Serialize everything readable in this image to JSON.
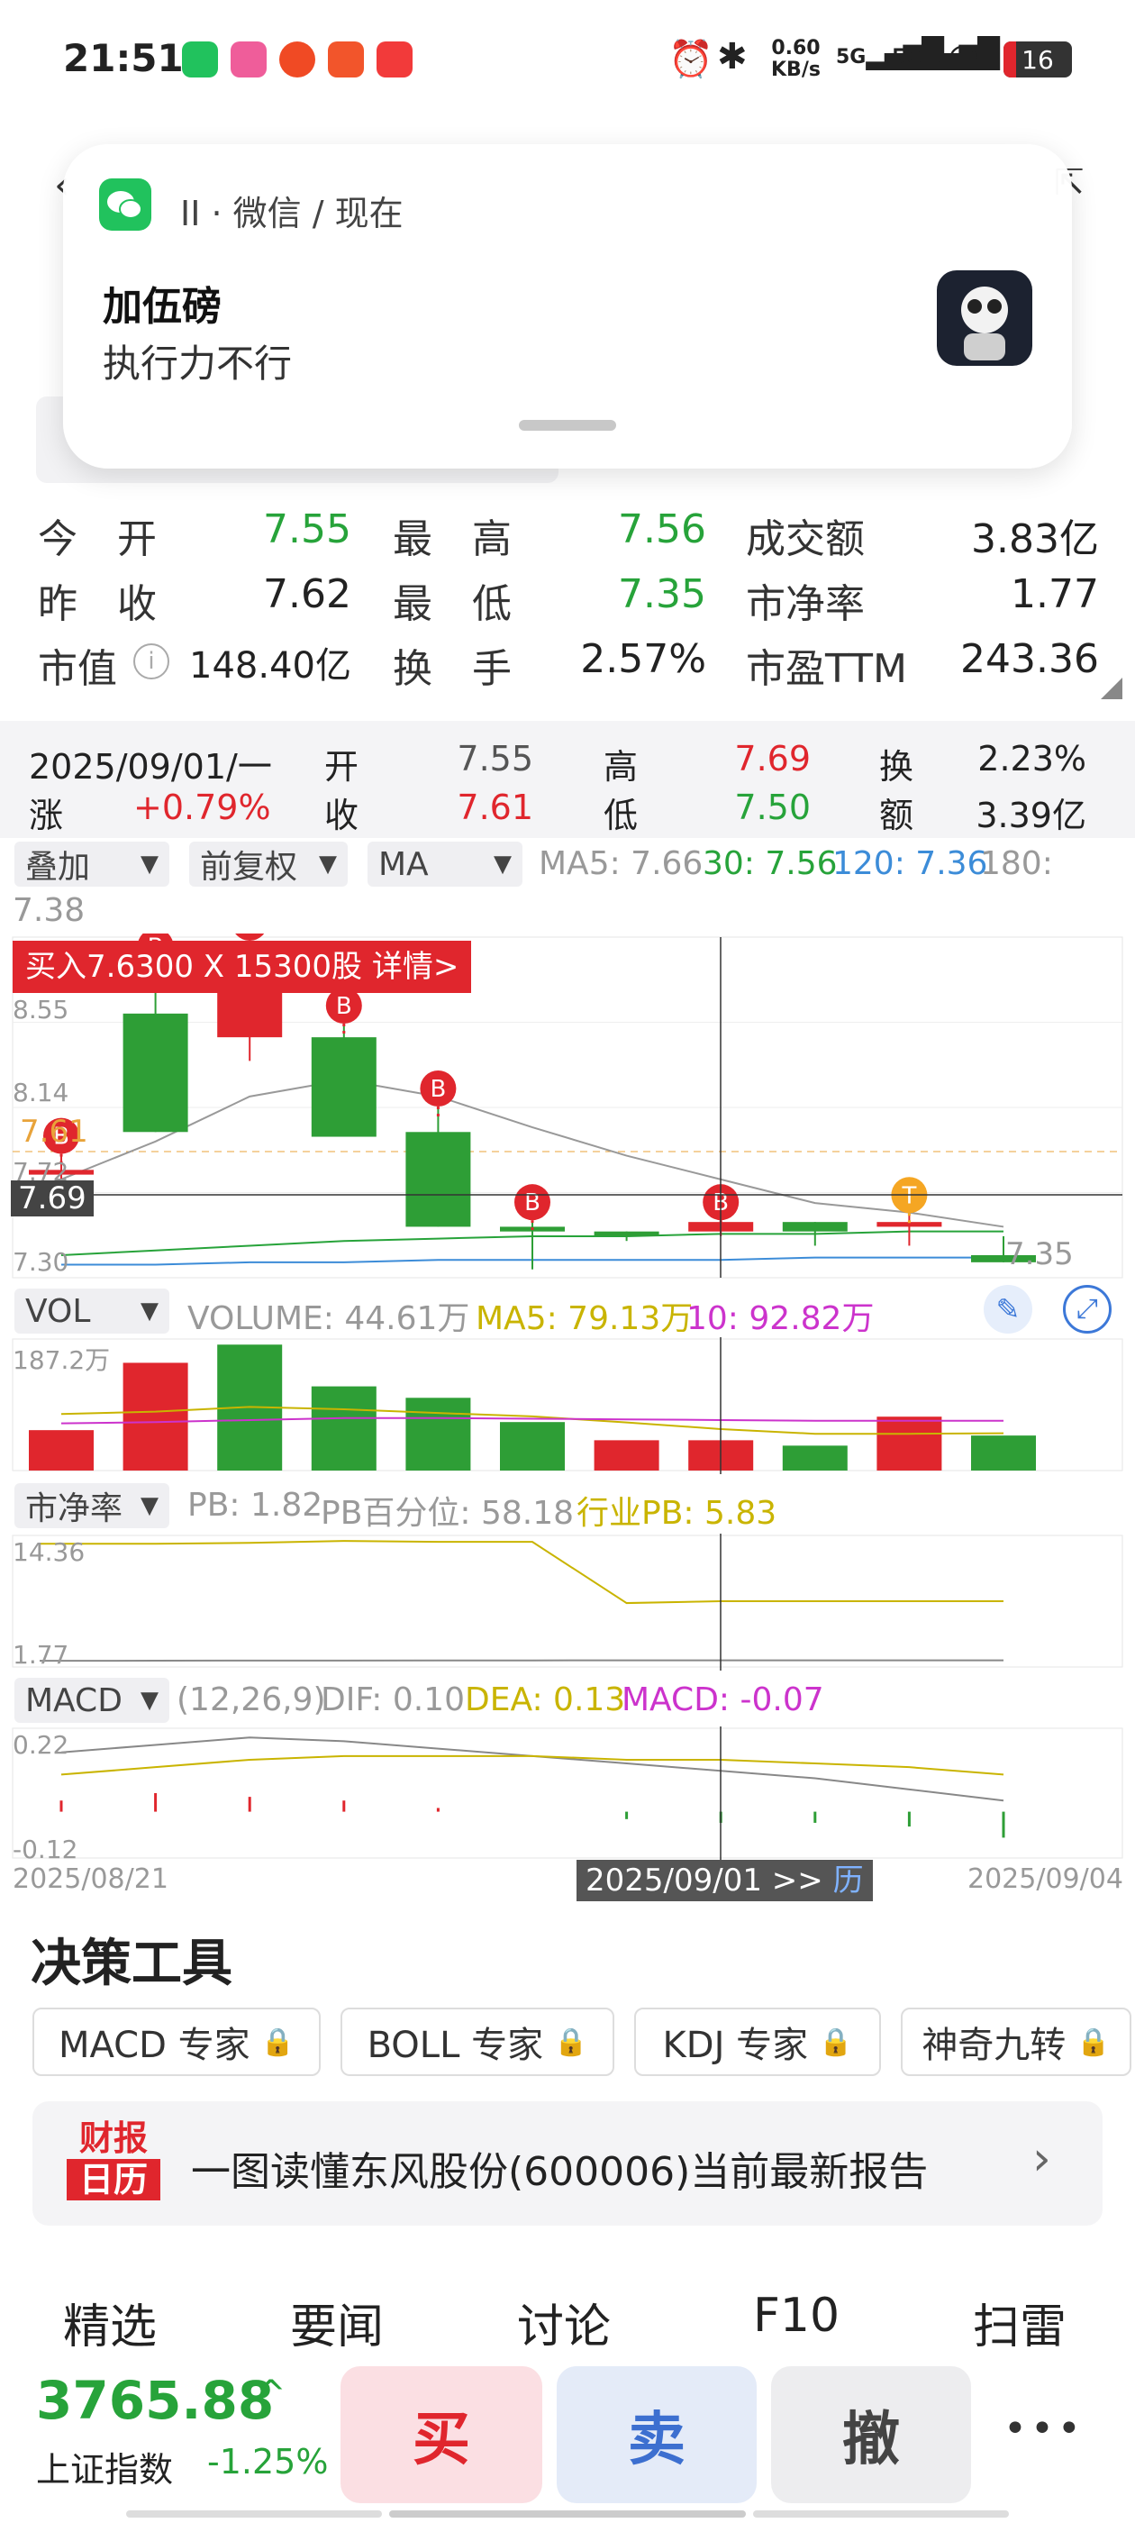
{
  "status_bar": {
    "time": "21:51",
    "net_speed_top": "0.60",
    "net_speed_bottom": "KB/s",
    "signal1": "5G",
    "signal2": "5G",
    "battery": "16",
    "colors": {
      "wechat": "#21c25d",
      "app2": "#ef5d9a",
      "app3": "#f04a24",
      "app4": "#f2552b",
      "app5": "#f23a3a"
    }
  },
  "notification": {
    "source": "II · 微信 / 现在",
    "title": "加伍磅",
    "body": "执行力不行"
  },
  "stats": {
    "rows": [
      [
        {
          "label": "今　开",
          "value": "7.55",
          "color": "green"
        },
        {
          "label": "最　高",
          "value": "7.56",
          "color": "green"
        },
        {
          "label": "成交额",
          "value": "3.83亿",
          "color": "black"
        }
      ],
      [
        {
          "label": "昨　收",
          "value": "7.62",
          "color": "black"
        },
        {
          "label": "最　低",
          "value": "7.35",
          "color": "green"
        },
        {
          "label": "市净率",
          "value": "1.77",
          "color": "black"
        }
      ],
      [
        {
          "label": "市值",
          "value": "148.40亿",
          "color": "black"
        },
        {
          "label": "换　手",
          "value": "2.57%",
          "color": "black"
        },
        {
          "label": "市盈TTM",
          "value": "243.36",
          "color": "black"
        }
      ]
    ]
  },
  "day_info": {
    "date": "2025/09/01/一",
    "open_label": "开",
    "open": "7.55",
    "high_label": "高",
    "high": "7.69",
    "turn_label": "换",
    "turn": "2.23%",
    "chg_label": "涨",
    "chg": "+0.79%",
    "close_label": "收",
    "close": "7.61",
    "low_label": "低",
    "low": "7.50",
    "amt_label": "额",
    "amt": "3.39亿"
  },
  "chart_controls": {
    "overlay": "叠加",
    "adjust": "前复权",
    "ma": "MA",
    "ma5": "MA5: 7.66",
    "ma30": "30: 7.56",
    "ma120": "120: 7.36",
    "ma180": "180:",
    "ma180_val": "7.38"
  },
  "trade_tag": "买入7.6300 X 15300股  详情>",
  "kline_labels": {
    "max": "8.55",
    "l2": "8.14",
    "l3": "7.72",
    "min": "7.30",
    "cursor": "7.69",
    "right_low": "7.35",
    "prev_close": "7.61"
  },
  "chart_data": [
    {
      "type": "candlestick",
      "categories": [
        "1",
        "2",
        "3",
        "4",
        "5",
        "6",
        "7",
        "8",
        "9",
        "10",
        "11"
      ],
      "ohlc": [
        [
          7.72,
          7.8,
          7.7,
          7.74
        ],
        [
          8.4,
          8.6,
          7.9,
          7.9
        ],
        [
          8.3,
          8.7,
          8.2,
          8.55
        ],
        [
          8.3,
          8.35,
          7.88,
          7.88
        ],
        [
          7.9,
          8.0,
          7.5,
          7.5
        ],
        [
          7.5,
          7.52,
          7.32,
          7.48
        ],
        [
          7.48,
          7.48,
          7.44,
          7.46
        ],
        [
          7.48,
          7.52,
          7.46,
          7.52
        ],
        [
          7.52,
          7.52,
          7.42,
          7.48
        ],
        [
          7.5,
          7.55,
          7.42,
          7.52
        ],
        [
          7.38,
          7.46,
          7.35,
          7.35
        ]
      ],
      "marks": [
        "B",
        "B",
        "B",
        "B",
        "B",
        "B",
        "",
        "B",
        "",
        "T",
        ""
      ],
      "ylim": [
        7.3,
        8.7
      ]
    },
    {
      "type": "bar",
      "title": "VOL",
      "label": "VOLUME: 44.61万",
      "ma5": "MA5: 79.13万",
      "ma10": "10: 92.82万",
      "max_label": "187.2万",
      "values": [
        60,
        160,
        187,
        125,
        108,
        72,
        45,
        45,
        37,
        80,
        52
      ],
      "colors": [
        "red",
        "red",
        "green",
        "green",
        "green",
        "green",
        "red",
        "red",
        "green",
        "red",
        "green"
      ],
      "ylim": [
        0,
        190
      ]
    },
    {
      "type": "line",
      "title": "市净率",
      "label_pb": "PB: 1.82",
      "label_pct": "PB百分位: 58.18",
      "label_ind": "行业PB: 5.83",
      "max_label": "14.36",
      "min_label": "1.77"
    },
    {
      "type": "bar",
      "title": "MACD",
      "params": "(12,26,9)",
      "dif": "DIF: 0.10",
      "dea": "DEA: 0.13",
      "macd": "MACD: -0.07",
      "max_label": "0.22",
      "min_label": "-0.12",
      "values": [
        0.03,
        0.05,
        0.04,
        0.03,
        0.01,
        0.0,
        -0.02,
        -0.03,
        -0.03,
        -0.04,
        -0.07
      ],
      "ylim": [
        -0.12,
        0.22
      ]
    }
  ],
  "date_axis": {
    "start": "2025/08/21",
    "cursor": "2025/09/01 >> ",
    "cursor_hist": "历",
    "end": "2025/09/04"
  },
  "tools": {
    "title": "决策工具",
    "items": [
      "MACD 专家",
      "BOLL 专家",
      "KDJ 专家",
      "神奇九转"
    ]
  },
  "report": {
    "logo_top": "财报",
    "logo_bottom": "日历",
    "text": "一图读懂东风股份(600006)当前最新报告"
  },
  "tabs": [
    "精选",
    "要闻",
    "讨论",
    "F10",
    "扫雷"
  ],
  "index": {
    "value": "3765.88",
    "name": "上证指数",
    "change": "-1.25%"
  },
  "actions": {
    "buy": "买",
    "sell": "卖",
    "cancel": "撤",
    "more": "•••"
  }
}
